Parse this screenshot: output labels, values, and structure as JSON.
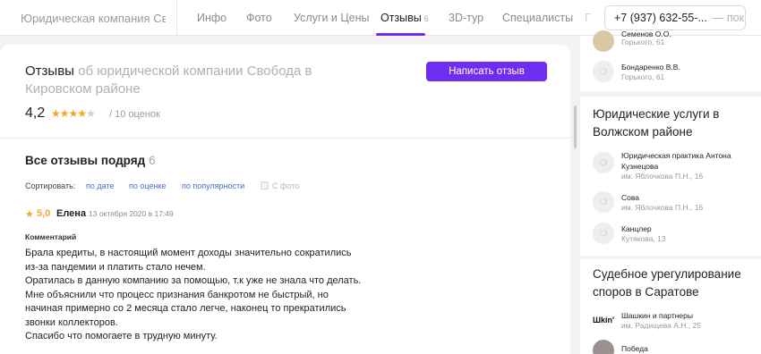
{
  "topbar": {
    "company": "Юридическая компания Свобода",
    "tabs": [
      {
        "label": "Инфо",
        "count": ""
      },
      {
        "label": "Фото",
        "count": ""
      },
      {
        "label": "Услуги и Цены",
        "count": ""
      },
      {
        "label": "Отзывы",
        "count": "6"
      },
      {
        "label": "3D-тур",
        "count": ""
      },
      {
        "label": "Специалисты",
        "count": ""
      },
      {
        "label": "Г",
        "count": ""
      }
    ],
    "phone": "+7 (937) 632-55-...",
    "show_label": "— показать"
  },
  "reviews_header": {
    "title": "Отзывы",
    "subtitle": "об юридической компании Свобода в Кировском районе",
    "write_button": "Написать отзыв",
    "rating": "4,2",
    "stars": 4,
    "rating_count": "/ 10 оценок"
  },
  "all_reviews": {
    "title": "Все отзывы подряд",
    "count": "6",
    "sort_label": "Сортировать:",
    "sort_options": [
      "по дате",
      "по оценке",
      "по популярности"
    ],
    "photo_filter": "С фото"
  },
  "review": {
    "score": "5,0",
    "author": "Елена",
    "date": "13 октября 2020 в 17:49",
    "comment_label": "Комментарий",
    "lines": [
      "Брала кредиты, в настоящий момент доходы значительно сократились из-за пандемии и платить стало нечем.",
      "Оратилась в данную компанию за помощью, т.к уже не знала что делать.",
      "Мне объяснили что процесс признания банкротом не быстрый, но начиная примерно со 2 месяца стало легче, наконец то прекратились звонки коллекторов.",
      "Спасибо что помогаете в трудную минуту."
    ]
  },
  "sidebar": {
    "top_items": [
      {
        "name": "Семенов О.О.",
        "address": "Горького, 61"
      },
      {
        "name": "Бондаренко В.В.",
        "address": "Горького, 61"
      }
    ],
    "volzhsky": {
      "title": "Юридические услуги в Волжском районе",
      "items": [
        {
          "name": "Юридическая практика Антона Кузнецова",
          "address": "им. Яблочкова П.Н., 16"
        },
        {
          "name": "Сова",
          "address": "им. Яблочкова П.Н., 16"
        },
        {
          "name": "Канцлер",
          "address": "Кутякова, 13"
        }
      ]
    },
    "saratov": {
      "title": "Судебное урегулирование споров в Саратове",
      "items": [
        {
          "name": "Шашкин и партнеры",
          "address": "им. Радищева А.Н., 25",
          "logo": "Шkin'"
        },
        {
          "name": "Победа",
          "address": ""
        }
      ]
    }
  }
}
